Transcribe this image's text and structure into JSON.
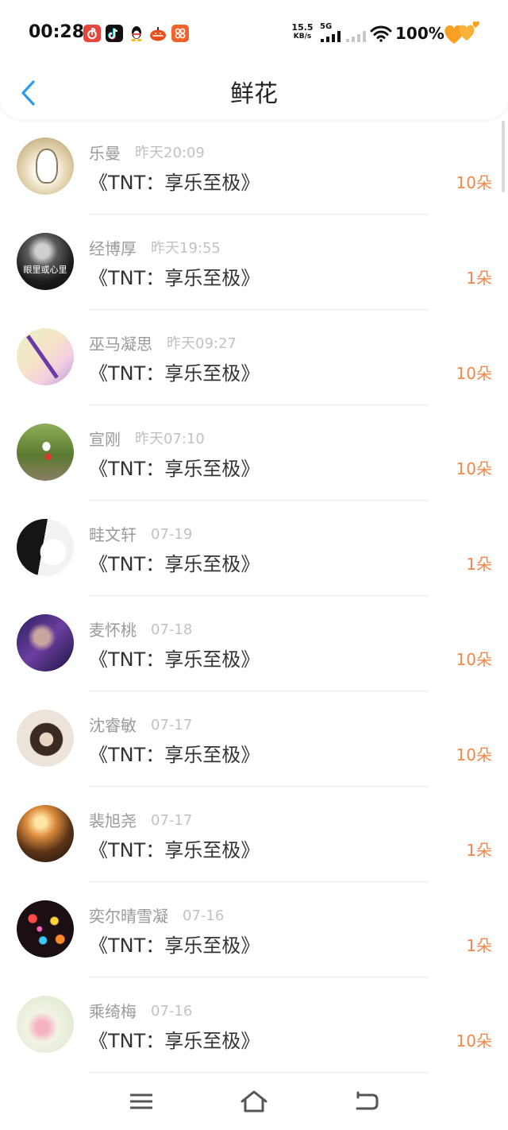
{
  "theme": {
    "accent_color": "#2A9BF0",
    "count_color": "#F0874A"
  },
  "status_bar": {
    "time": "00:28",
    "notification_icons": [
      "netease-music-icon",
      "tiktok-icon",
      "qq-penguin-icon",
      "taobao-icon",
      "app-grid-icon"
    ],
    "net_speed_value": "15.5",
    "net_speed_unit": "KB/s",
    "network_type": "5G",
    "battery": "100%",
    "right_icons": [
      "signal-bars-icon",
      "signal-bars-empty-icon",
      "wifi-icon",
      "heart-battery-icon"
    ]
  },
  "header": {
    "title": "鲜花",
    "back_icon": "chevron-left-icon"
  },
  "items": [
    {
      "name": "乐曼",
      "time": "昨天20:09",
      "work": "《TNT：享乐至极》",
      "count": "10朵"
    },
    {
      "name": "经博厚",
      "time": "昨天19:55",
      "work": "《TNT：享乐至极》",
      "count": "1朵",
      "avatar_caption": "眼里或心里"
    },
    {
      "name": "巫马凝思",
      "time": "昨天09:27",
      "work": "《TNT：享乐至极》",
      "count": "10朵"
    },
    {
      "name": "宣刚",
      "time": "昨天07:10",
      "work": "《TNT：享乐至极》",
      "count": "10朵"
    },
    {
      "name": "畦文轩",
      "time": "07-19",
      "work": "《TNT：享乐至极》",
      "count": "1朵"
    },
    {
      "name": "麦怀桃",
      "time": "07-18",
      "work": "《TNT：享乐至极》",
      "count": "10朵"
    },
    {
      "name": "沈睿敏",
      "time": "07-17",
      "work": "《TNT：享乐至极》",
      "count": "10朵"
    },
    {
      "name": "裴旭尧",
      "time": "07-17",
      "work": "《TNT：享乐至极》",
      "count": "1朵"
    },
    {
      "name": "奕尔晴雪凝",
      "time": "07-16",
      "work": "《TNT：享乐至极》",
      "count": "1朵"
    },
    {
      "name": "乘绮梅",
      "time": "07-16",
      "work": "《TNT：享乐至极》",
      "count": "10朵"
    }
  ],
  "nav_bar": {
    "icons": [
      "menu-icon",
      "home-icon",
      "back-icon"
    ]
  }
}
